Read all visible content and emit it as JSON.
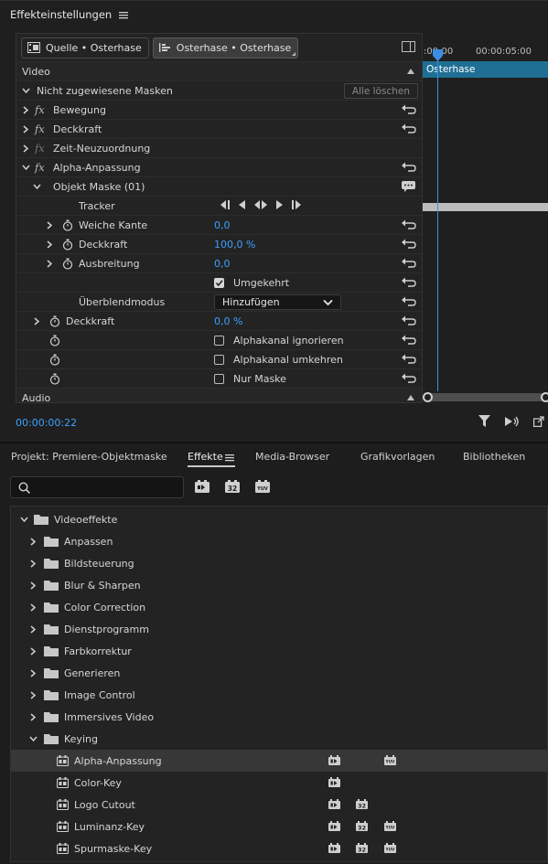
{
  "effect_controls": {
    "title": "Effekteinstellungen",
    "source_tab": "Quelle • Osterhase",
    "sequence_tab": "Osterhase • Osterhase",
    "section_video": "Video",
    "masks_label": "Nicht zugewiesene Masken",
    "clear_all": "Alle löschen",
    "effects": {
      "motion": "Bewegung",
      "opacity": "Deckkraft",
      "time_remap": "Zeit-Neuzuordnung",
      "alpha_adjust": "Alpha-Anpassung"
    },
    "mask": {
      "name": "Objekt Maske (01)",
      "tracker": "Tracker",
      "feather_label": "Weiche Kante",
      "feather_value": "0,0",
      "opacity_label": "Deckkraft",
      "opacity_value": "100,0 %",
      "expansion_label": "Ausbreitung",
      "expansion_value": "0,0",
      "inverted_label": "Umgekehrt",
      "inverted_checked": true,
      "blend_label": "Überblendmodus",
      "blend_value": "Hinzufügen"
    },
    "alpha_opacity_label": "Deckkraft",
    "alpha_opacity_value": "0,0 %",
    "ignore_alpha": "Alphakanal ignorieren",
    "invert_alpha": "Alphakanal umkehren",
    "mask_only": "Nur Maske",
    "section_audio": "Audio",
    "timecode": "00:00:00:22",
    "timeline": {
      "tc_start": ":00:00",
      "tc_end": "00:00:05:00",
      "clip_name": "Osterhase"
    }
  },
  "project_panel": {
    "tabs": [
      "Projekt: Premiere-Objektmaske",
      "Effekte",
      "Media-Browser",
      "Grafikvorlagen",
      "Bibliotheken"
    ],
    "search_placeholder": "",
    "tree": {
      "root": "Videoeffekte",
      "folders": [
        "Anpassen",
        "Bildsteuerung",
        "Blur & Sharpen",
        "Color Correction",
        "Dienstprogramm",
        "Farbkorrektur",
        "Generieren",
        "Image Control",
        "Immersives Video",
        "Keying"
      ],
      "keying_items": [
        {
          "label": "Alpha-Anpassung",
          "accel": true,
          "bit32": false,
          "yuv": true
        },
        {
          "label": "Color-Key",
          "accel": true,
          "bit32": false,
          "yuv": false
        },
        {
          "label": "Logo Cutout",
          "accel": true,
          "bit32": true,
          "yuv": false
        },
        {
          "label": "Luminanz-Key",
          "accel": true,
          "bit32": true,
          "yuv": true
        },
        {
          "label": "Spurmaske-Key",
          "accel": true,
          "bit32": true,
          "yuv": true
        }
      ]
    },
    "badges": {
      "bit32": "32",
      "yuv": "YUV"
    }
  }
}
